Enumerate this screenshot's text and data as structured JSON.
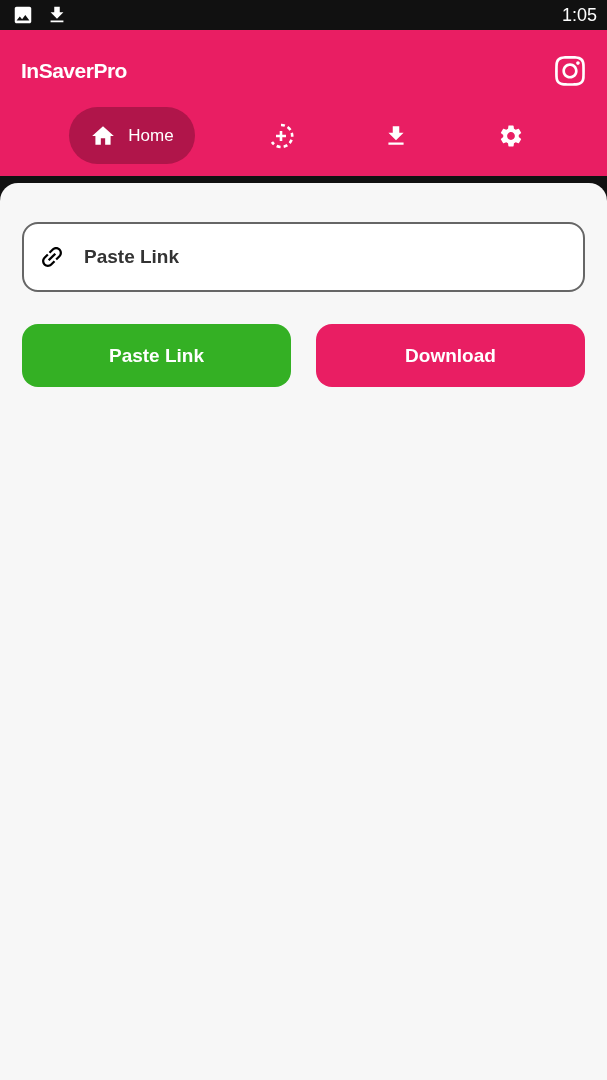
{
  "status_bar": {
    "time": "1:05"
  },
  "app_bar": {
    "title": "InSaverPro"
  },
  "tabs": [
    {
      "kind": "home",
      "label": "Home",
      "selected": true
    },
    {
      "kind": "add",
      "selected": false
    },
    {
      "kind": "download",
      "selected": false
    },
    {
      "kind": "settings",
      "selected": false
    }
  ],
  "link_field": {
    "placeholder": "Paste Link"
  },
  "buttons": [
    {
      "kind": "paste",
      "label": "Paste Link"
    },
    {
      "kind": "download",
      "label": "Download"
    }
  ]
}
